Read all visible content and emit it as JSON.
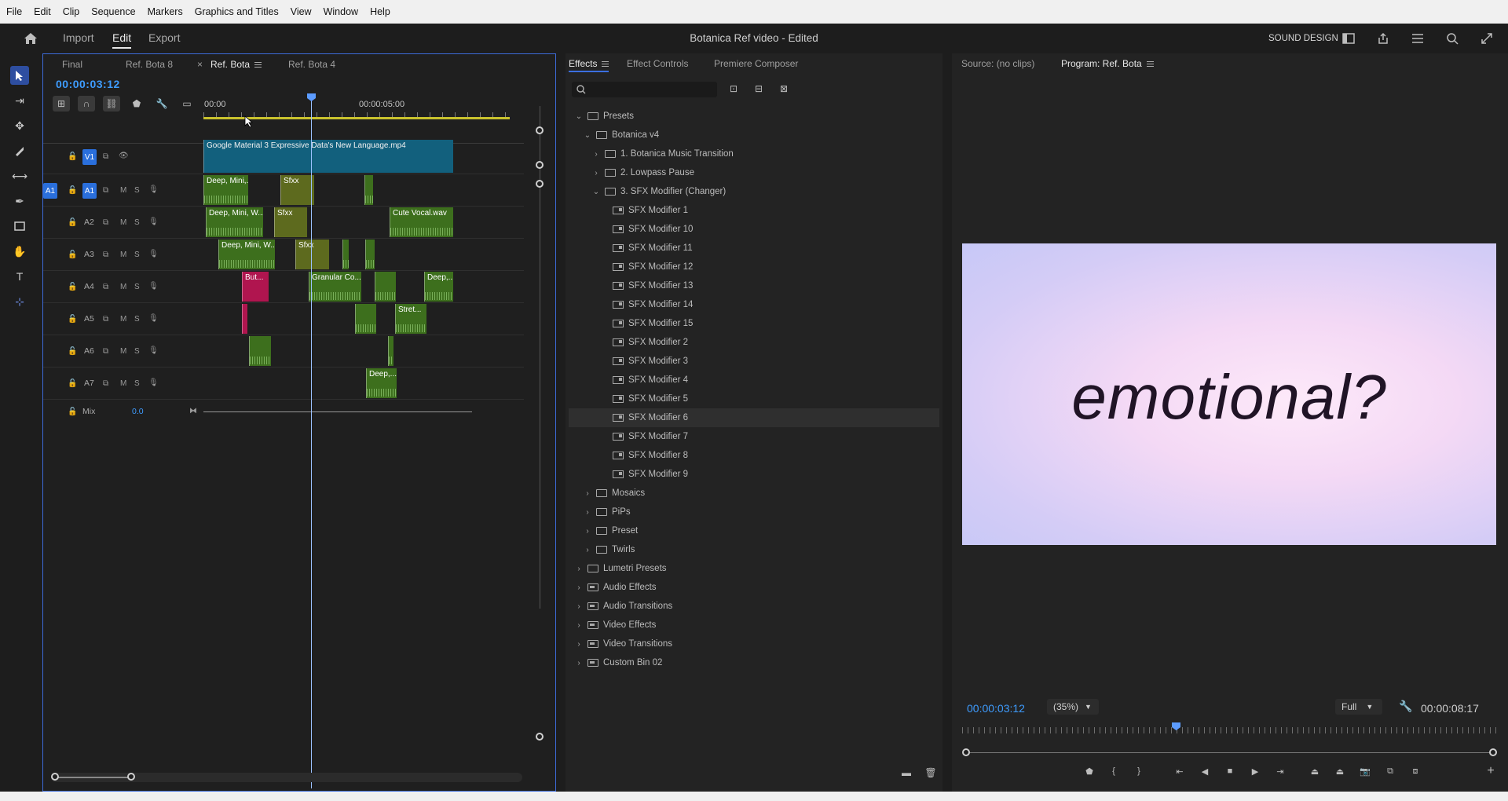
{
  "menubar": [
    "File",
    "Edit",
    "Clip",
    "Sequence",
    "Markers",
    "Graphics and Titles",
    "View",
    "Window",
    "Help"
  ],
  "header": {
    "tabs": [
      "Import",
      "Edit",
      "Export"
    ],
    "active_tab": "Edit",
    "title": "Botanica Ref video",
    "title_suffix": " - Edited",
    "workspace": "SOUND DESIGN"
  },
  "timeline": {
    "tabs": [
      "Final",
      "Ref. Bota 8",
      "Ref. Bota",
      "Ref. Bota 4"
    ],
    "active_tab": "Ref. Bota",
    "timecode": "00:00:03:12",
    "ruler": [
      "00:00",
      "00:00:05:00"
    ],
    "video_tracks": [
      {
        "name": "V1"
      }
    ],
    "audio_tracks": [
      "A1",
      "A2",
      "A3",
      "A4",
      "A5",
      "A6",
      "A7"
    ],
    "track_buttons": {
      "mute": "M",
      "solo": "S"
    },
    "mix": {
      "label": "Mix",
      "value": "0.0"
    },
    "clips": {
      "v1": "Google Material 3 Expressive   Data's New Language.mp4",
      "deep_mini_short": "Deep, Mini,...",
      "deep_mini_w": "Deep, Mini, W...",
      "sfx": "Sfxx",
      "cute_vocal": "Cute Vocal.wav",
      "but": "But...",
      "granular": "Granular Co...",
      "deep": "Deep,...",
      "stret": "Stret...",
      "deep_a7": "Deep,..."
    }
  },
  "effects": {
    "tabs": [
      "Effects",
      "Effect Controls",
      "Premiere Composer"
    ],
    "active_tab": "Effects",
    "search": {
      "placeholder": ""
    },
    "tree": [
      {
        "label": "Presets",
        "level": 0,
        "state": "open",
        "icon": "preset-folder"
      },
      {
        "label": "Botanica v4",
        "level": 1,
        "state": "open",
        "icon": "preset-folder"
      },
      {
        "label": "1. Botanica Music Transition",
        "level": 2,
        "state": "closed",
        "icon": "preset-folder"
      },
      {
        "label": "2. Lowpass Pause",
        "level": 2,
        "state": "closed",
        "icon": "preset-folder"
      },
      {
        "label": "3. SFX Modifier (Changer)",
        "level": 2,
        "state": "open",
        "icon": "preset-folder"
      },
      {
        "label": "SFX Modifier 1",
        "level": 3,
        "icon": "preset"
      },
      {
        "label": "SFX Modifier 10",
        "level": 3,
        "icon": "preset"
      },
      {
        "label": "SFX Modifier 11",
        "level": 3,
        "icon": "preset"
      },
      {
        "label": "SFX Modifier 12",
        "level": 3,
        "icon": "preset"
      },
      {
        "label": "SFX Modifier 13",
        "level": 3,
        "icon": "preset"
      },
      {
        "label": "SFX Modifier 14",
        "level": 3,
        "icon": "preset"
      },
      {
        "label": "SFX Modifier 15",
        "level": 3,
        "icon": "preset"
      },
      {
        "label": "SFX Modifier 2",
        "level": 3,
        "icon": "preset"
      },
      {
        "label": "SFX Modifier 3",
        "level": 3,
        "icon": "preset"
      },
      {
        "label": "SFX Modifier 4",
        "level": 3,
        "icon": "preset"
      },
      {
        "label": "SFX Modifier 5",
        "level": 3,
        "icon": "preset"
      },
      {
        "label": "SFX Modifier 6",
        "level": 3,
        "icon": "preset",
        "selected": true
      },
      {
        "label": "SFX Modifier 7",
        "level": 3,
        "icon": "preset"
      },
      {
        "label": "SFX Modifier 8",
        "level": 3,
        "icon": "preset"
      },
      {
        "label": "SFX Modifier 9",
        "level": 3,
        "icon": "preset"
      },
      {
        "label": "Mosaics",
        "level": 1,
        "state": "closed",
        "icon": "preset-folder"
      },
      {
        "label": "PiPs",
        "level": 1,
        "state": "closed",
        "icon": "preset-folder"
      },
      {
        "label": "Preset",
        "level": 1,
        "state": "closed",
        "icon": "preset-folder"
      },
      {
        "label": "Twirls",
        "level": 1,
        "state": "closed",
        "icon": "preset-folder"
      },
      {
        "label": "Lumetri Presets",
        "level": 0,
        "state": "closed",
        "icon": "preset-folder"
      },
      {
        "label": "Audio Effects",
        "level": 0,
        "state": "closed",
        "icon": "bin"
      },
      {
        "label": "Audio Transitions",
        "level": 0,
        "state": "closed",
        "icon": "bin"
      },
      {
        "label": "Video Effects",
        "level": 0,
        "state": "closed",
        "icon": "bin"
      },
      {
        "label": "Video Transitions",
        "level": 0,
        "state": "closed",
        "icon": "bin"
      },
      {
        "label": "Custom Bin 02",
        "level": 0,
        "state": "closed",
        "icon": "bin"
      }
    ]
  },
  "monitor": {
    "tabs": [
      "Source: (no clips)",
      "Program: Ref. Bota"
    ],
    "active_tab": "Program: Ref. Bota",
    "frame_text": "emotional?",
    "timecode": "00:00:03:12",
    "zoom": "(35%)",
    "quality": "Full",
    "duration": "00:00:08:17",
    "playhead_fraction": 0.4
  },
  "colors": {
    "accent": "#3e9cff",
    "audio_clip": "#3d6f1d",
    "video_clip": "#12607d",
    "pink_clip": "#b0154f",
    "work_area": "#c9c22d"
  }
}
